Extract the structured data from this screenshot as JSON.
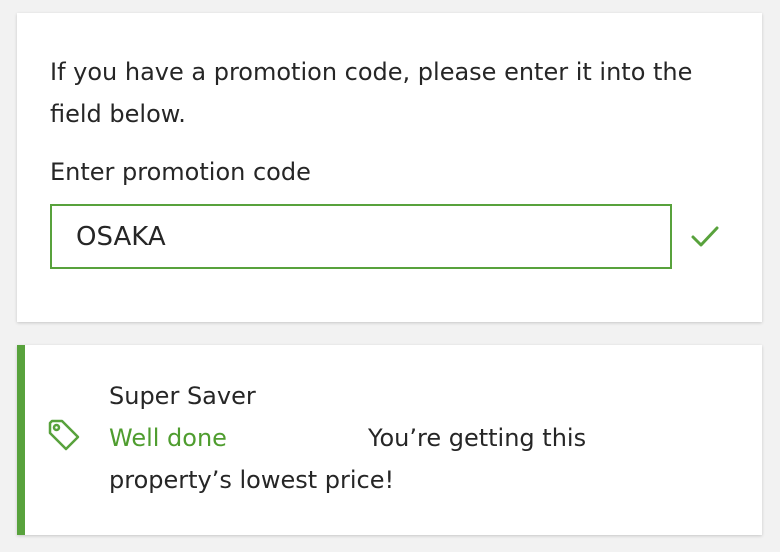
{
  "promo": {
    "intro_text": "If you have a promotion code, please enter it into the field below.",
    "field_label": "Enter promotion code",
    "code_value": "OSAKA",
    "validation_icon": "check-icon"
  },
  "deal": {
    "name": "Super Saver",
    "status": "Well done",
    "message": "You’re getting this property’s lowest price!",
    "icon": "tag-icon"
  },
  "colors": {
    "accent_green": "#58a23c",
    "text": "#262626",
    "background": "#f2f2f2",
    "card": "#ffffff"
  }
}
